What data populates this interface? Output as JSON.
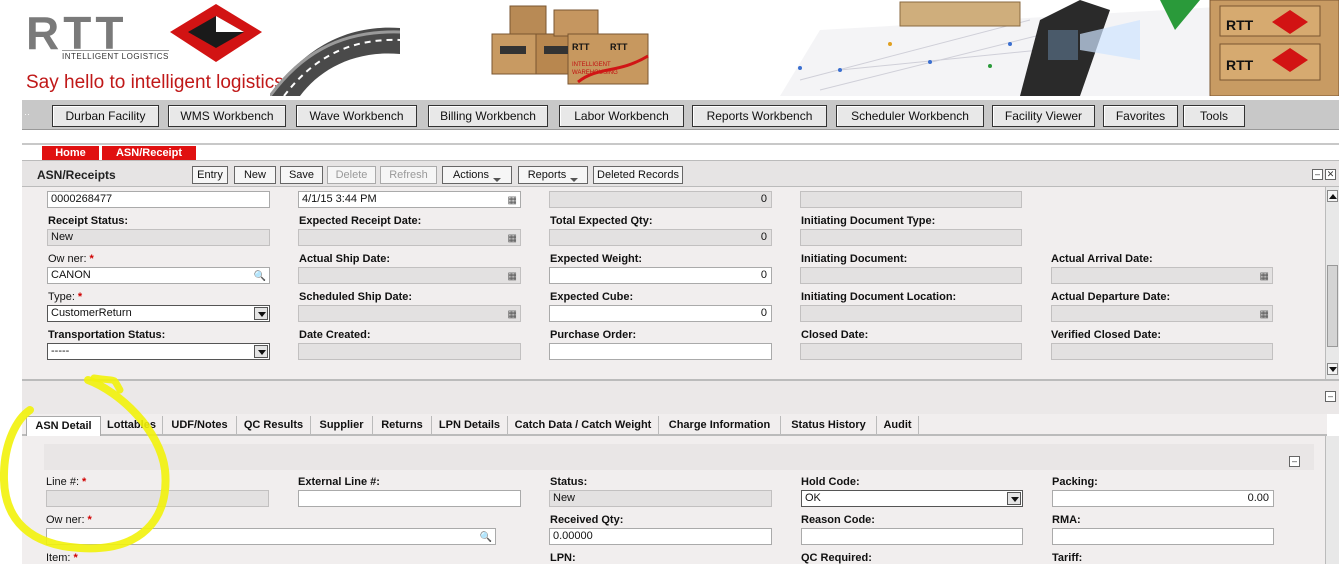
{
  "banner": {
    "logo_text": "RTT",
    "logo_subtext": "INTELLIGENT LOGISTICS",
    "tagline": "Say hello to intelligent logistics.",
    "box_label_1": "RTT",
    "box_label_2": "RTT",
    "box_label_3": "INTELLIGENT WAREHOUSING",
    "right_box_label_1": "RTT",
    "right_box_label_2": "RTT"
  },
  "nav": {
    "items": [
      "Durban Facility",
      "WMS Workbench",
      "Wave Workbench",
      "Billing Workbench",
      "Labor Workbench",
      "Reports Workbench",
      "Scheduler Workbench",
      "Facility Viewer",
      "Favorites",
      "Tools"
    ]
  },
  "breadcrumb": {
    "home": "Home",
    "current": "ASN/Receipt"
  },
  "toolbar": {
    "title": "ASN/Receipts",
    "entry": "Entry",
    "new": "New",
    "save": "Save",
    "delete": "Delete",
    "refresh": "Refresh",
    "actions": "Actions",
    "reports": "Reports",
    "deleted_records": "Deleted Records"
  },
  "header_form": {
    "receipt_no": "0000268477",
    "date_value": "4/1/15 3:44 PM",
    "top_qty": "0",
    "receipt_status_label": "Receipt Status:",
    "receipt_status_value": "New",
    "expected_receipt_date_label": "Expected Receipt Date:",
    "total_expected_qty_label": "Total Expected Qty:",
    "total_expected_qty_value": "0",
    "initiating_document_type_label": "Initiating Document Type:",
    "owner_label": "Ow ner:",
    "owner_value": "CANON",
    "actual_ship_date_label": "Actual Ship Date:",
    "expected_weight_label": "Expected Weight:",
    "expected_weight_value": "0",
    "initiating_document_label": "Initiating Document:",
    "actual_arrival_date_label": "Actual Arrival Date:",
    "type_label": "Type:",
    "type_value": "CustomerReturn",
    "scheduled_ship_date_label": "Scheduled Ship Date:",
    "expected_cube_label": "Expected Cube:",
    "expected_cube_value": "0",
    "initiating_document_location_label": "Initiating Document Location:",
    "actual_departure_date_label": "Actual Departure Date:",
    "transportation_status_label": "Transportation Status:",
    "transportation_status_value": "-----",
    "date_created_label": "Date Created:",
    "purchase_order_label": "Purchase Order:",
    "closed_date_label": "Closed Date:",
    "verified_closed_date_label": "Verified Closed Date:"
  },
  "detail_tabs": [
    "ASN Detail",
    "Lottables",
    "UDF/Notes",
    "QC Results",
    "Supplier",
    "Returns",
    "LPN Details",
    "Catch Data / Catch Weight",
    "Charge Information",
    "Status History",
    "Audit"
  ],
  "detail_form": {
    "line_label": "Line #:",
    "external_line_label": "External Line #:",
    "status_label": "Status:",
    "status_value": "New",
    "hold_code_label": "Hold Code:",
    "hold_code_value": "OK",
    "packing_label": "Packing:",
    "packing_value": "0.00",
    "owner_label": "Ow ner:",
    "received_qty_label": "Received Qty:",
    "received_qty_value": "0.00000",
    "reason_code_label": "Reason Code:",
    "rma_label": "RMA:",
    "item_label": "Item:",
    "lpn_label": "LPN:",
    "qc_required_label": "QC Required:",
    "tariff_label": "Tariff:"
  },
  "colors": {
    "brand_red": "#e01010",
    "highlight": "#f2f20a",
    "panel_bg": "#f1eeee"
  }
}
